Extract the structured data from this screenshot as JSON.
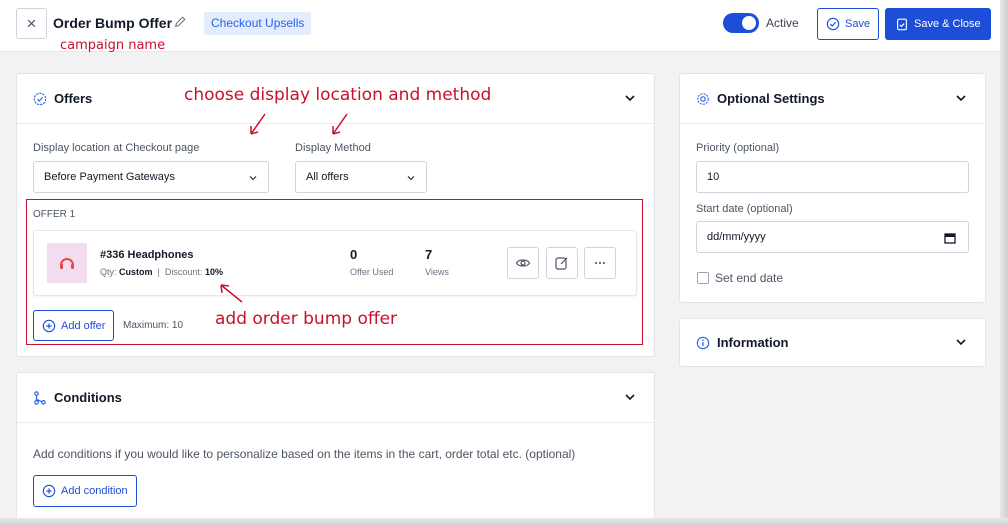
{
  "header": {
    "close_glyph": "×",
    "title": "Order Bump Offer",
    "tag": "Checkout Upsells",
    "active_label": "Active",
    "save_label": "Save",
    "save_close_label": "Save & Close"
  },
  "annotations": {
    "campaign_name": "campaign name",
    "display_location": "choose display location and method",
    "add_offer": "add order bump offer"
  },
  "offers": {
    "heading": "Offers",
    "location_label": "Display location at Checkout page",
    "location_value": "Before Payment Gateways",
    "method_label": "Display Method",
    "method_value": "All offers",
    "offer_label": "OFFER 1",
    "offer": {
      "name": "#336 Headphones",
      "qty_label": "Qty:",
      "qty_value": "Custom",
      "separator": "|",
      "discount_label": "Discount:",
      "discount_value": "10%",
      "used_value": "0",
      "used_label": "Offer Used",
      "views_value": "7",
      "views_label": "Views"
    },
    "add_offer_label": "Add offer",
    "maximum_text": "Maximum: 10"
  },
  "conditions": {
    "heading": "Conditions",
    "description": "Add conditions if you would like to personalize based on the items in the cart, order total etc. (optional)",
    "add_condition_label": "Add condition"
  },
  "optional_settings": {
    "heading": "Optional Settings",
    "priority_label": "Priority (optional)",
    "priority_value": "10",
    "start_date_label": "Start date (optional)",
    "start_date_value": "dd/mm/yyyy",
    "end_date_label": "Set end date"
  },
  "information": {
    "heading": "Information"
  },
  "colors": {
    "primary": "#1d4ed8",
    "annotation": "#c8102e",
    "tag_bg": "#e5ecfb"
  }
}
